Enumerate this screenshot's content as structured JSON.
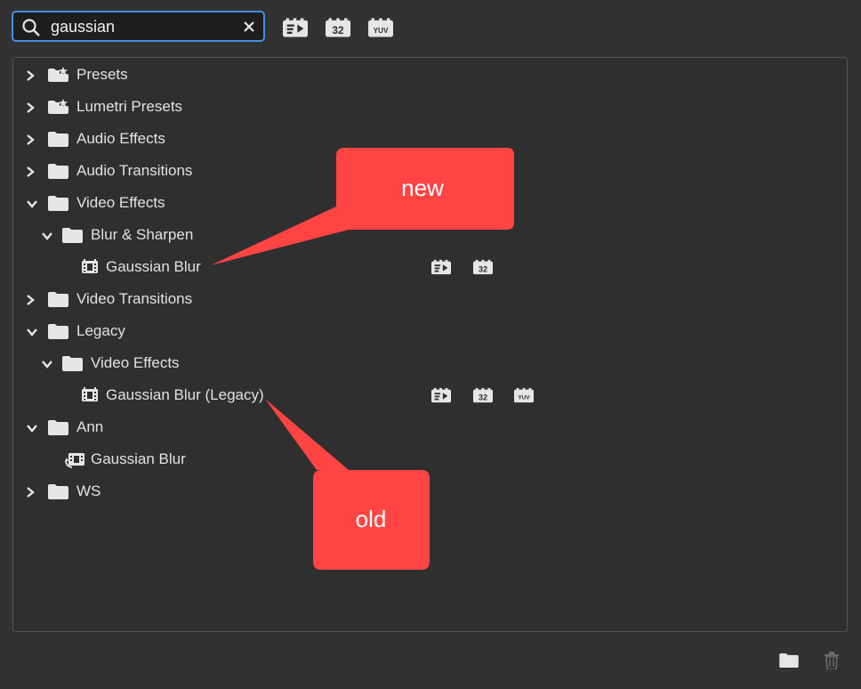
{
  "search": {
    "value": "gaussian",
    "placeholder": ""
  },
  "toolbar": {
    "accelerated_icon": "accelerated-effects-icon",
    "bit32_icon": "32bit-color-icon",
    "yuv_icon": "yuv-effects-icon"
  },
  "tree": {
    "presets": "Presets",
    "lumetri_presets": "Lumetri Presets",
    "audio_effects": "Audio Effects",
    "audio_transitions": "Audio Transitions",
    "video_effects": "Video Effects",
    "blur_sharpen": "Blur & Sharpen",
    "gaussian_blur": "Gaussian Blur",
    "video_transitions": "Video Transitions",
    "legacy": "Legacy",
    "legacy_video_effects": "Video Effects",
    "gaussian_blur_legacy": "Gaussian Blur (Legacy)",
    "ann": "Ann",
    "ann_gaussian_blur": "Gaussian Blur",
    "ws": "WS"
  },
  "callouts": {
    "new": "new",
    "old": "old"
  },
  "badges": {
    "bit32": "32",
    "yuv": "YUV"
  },
  "colors": {
    "accent": "#4a8ee6",
    "callout": "#ff4444",
    "background": "#323232"
  }
}
